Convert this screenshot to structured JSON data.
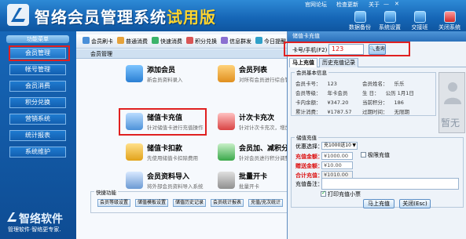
{
  "app": {
    "title_main": "智络会员管理系统",
    "title_trial": "试用版",
    "top_links": [
      "官网论坛",
      "检查更新",
      "关于"
    ],
    "top_buttons": [
      "数据备份",
      "系统设置",
      "交接班",
      "关闭系统"
    ]
  },
  "sidebar": {
    "heading": "功能菜单",
    "items": [
      "会员管理",
      "帐号管理",
      "会员消费",
      "积分兑换",
      "营销系统",
      "统计报表",
      "系统维护"
    ],
    "active_index": 0,
    "logo_text": "智络软件",
    "slogan": "管理软件·智络更专家."
  },
  "toolbar": {
    "items": [
      "会员刷卡",
      "普通消费",
      "快速消费",
      "积分兑换",
      "信息群发",
      "今日提醒"
    ]
  },
  "breadcrumb": "会员管理",
  "features": [
    {
      "name": "添加会员",
      "desc": "新会员资料录入"
    },
    {
      "name": "会员列表",
      "desc": "对所有会员进行综合管理"
    },
    {
      "name": "储值卡充值",
      "desc": "针对储值卡进行充值操作"
    },
    {
      "name": "计次卡充次",
      "desc": "针对计次卡充次，增加项目"
    },
    {
      "name": "储值卡扣款",
      "desc": "先使用储值卡扣除费用"
    },
    {
      "name": "会员加、减积分",
      "desc": "针对会员进行积分调整"
    },
    {
      "name": "会员资料导入",
      "desc": "将外部会员资料导入系统"
    },
    {
      "name": "批量开卡",
      "desc": "批量开卡"
    }
  ],
  "quick": {
    "title": "快捷功能",
    "buttons": [
      "会员等级设置",
      "储值模板设置",
      "储值历史记录",
      "会员统计报表",
      "充值/充次统计"
    ]
  },
  "dialog": {
    "title": "储值卡充值",
    "card_label": "卡号/手机(F2)",
    "card_value": "123",
    "search_label": "查询",
    "tabs": [
      "马上充值",
      "历史充值记录"
    ],
    "info_title": "会员基本信息",
    "info": [
      {
        "label": "会员卡号：",
        "value": "123"
      },
      {
        "label": "会员姓名：",
        "value": "乐乐"
      },
      {
        "label": "会员等级：",
        "value": "年卡会员"
      },
      {
        "label": "生    日：",
        "value": "公历 1月1日"
      },
      {
        "label": "卡内余额：",
        "value": "¥347.20"
      },
      {
        "label": "当前积分：",
        "value": "186"
      },
      {
        "label": "累计消费：",
        "value": "¥1787.57"
      },
      {
        "label": "过期时间：",
        "value": "无限期"
      }
    ],
    "photo_label": "暂无",
    "charge_title": "储值充值",
    "plan_label": "优惠选择：",
    "plan_value": "充1000送10",
    "charge_amount_label": "充值金额：",
    "charge_amount_value": "¥1000.00",
    "bonus_label": "赠送金额：",
    "bonus_value": "¥10.00",
    "total_label": "合计充值：",
    "total_value": "¥1010.00",
    "fixed_charge": "极限充值",
    "notes_label": "充值备注：",
    "print_label": "打印充值小票",
    "btn_charge": "马上充值",
    "btn_close": "关闭(Esc)"
  }
}
